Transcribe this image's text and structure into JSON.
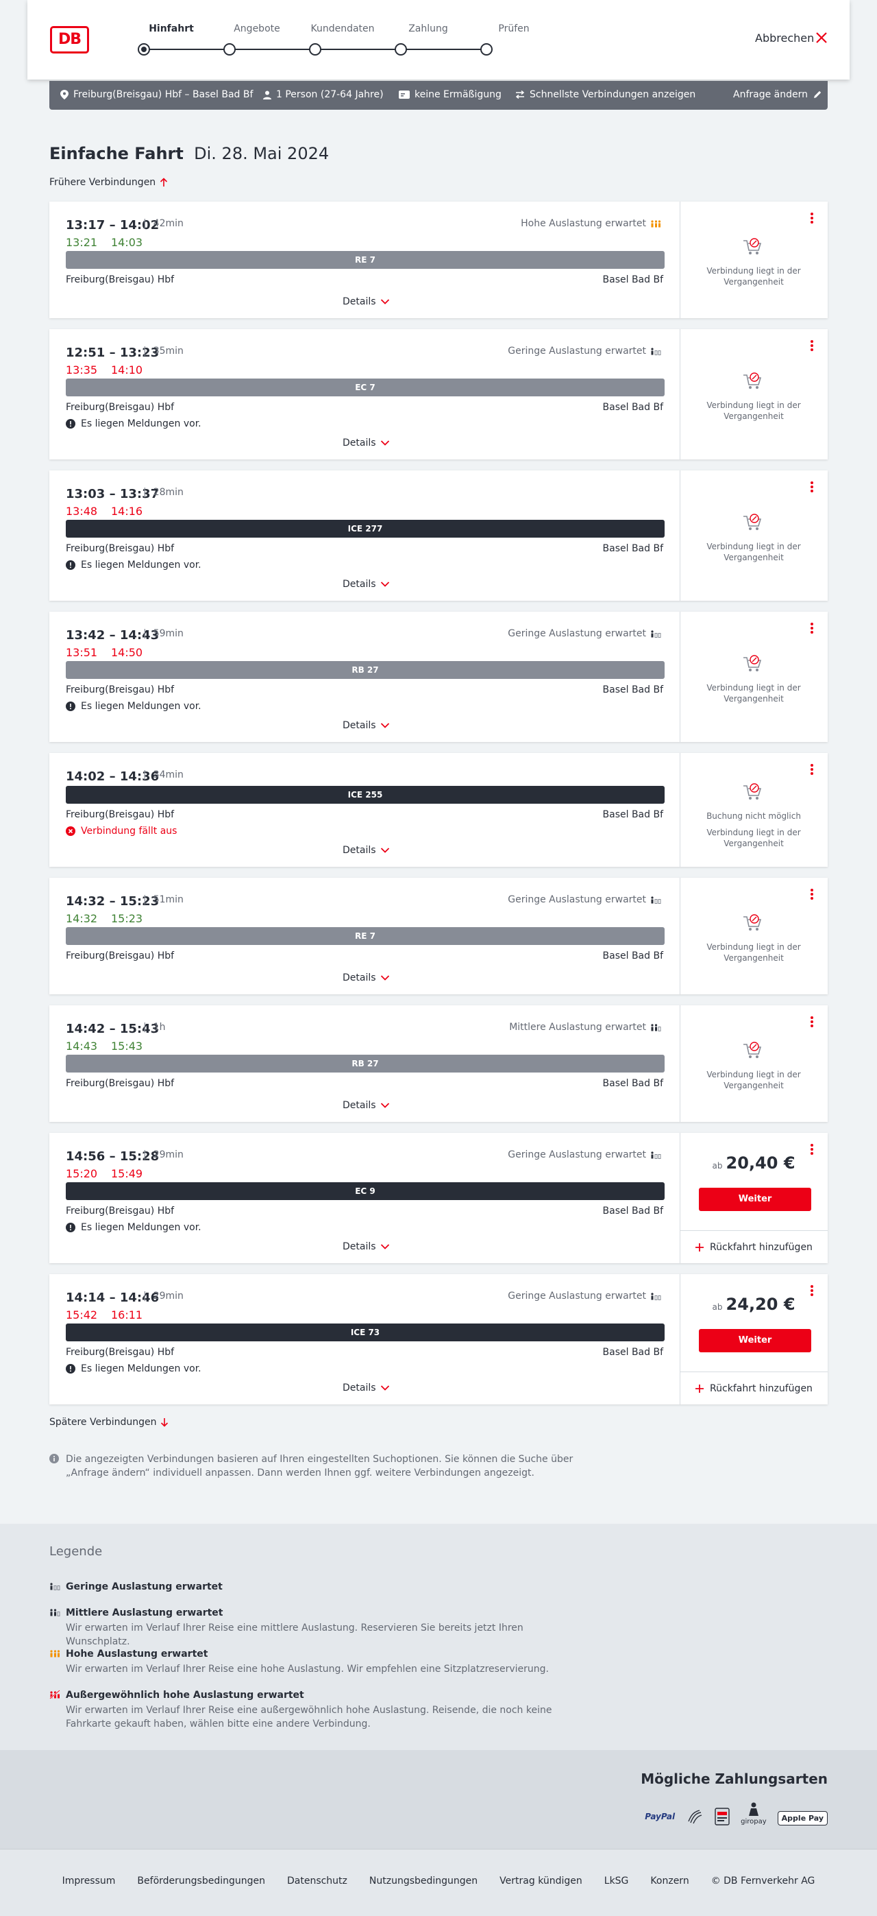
{
  "header": {
    "logo": "DB",
    "steps": [
      "Hinfahrt",
      "Angebote",
      "Kundendaten",
      "Zahlung",
      "Prüfen"
    ],
    "active_step": 0,
    "cancel_label": "Abbrechen"
  },
  "search": {
    "route": "Freiburg(Breisgau) Hbf – Basel Bad Bf",
    "travellers": "1 Person (27-64 Jahre)",
    "discount": "keine Ermäßigung",
    "fastest": "Schnellste Verbindungen anzeigen",
    "change": "Anfrage ändern"
  },
  "title": {
    "kind": "Einfache Fahrt",
    "date": "Di. 28. Mai 2024"
  },
  "earlier_label": "Frühere Verbindungen",
  "later_label": "Spätere Verbindungen",
  "details_label": "Details",
  "past_text": "Verbindung liegt in der Vergangenheit",
  "not_bookable_text": "Buchung nicht möglich",
  "price_prefix": "ab",
  "continue_label": "Weiter",
  "return_label": "Rückfahrt hinzufügen",
  "connections": [
    {
      "time": "13:17 – 14:02",
      "duration": "42min",
      "occupancy": "Hohe Auslastung erwartet",
      "occ_level": "high",
      "rt_dep": "13:21",
      "rt_arr": "14:03",
      "rt_color": "green",
      "train": "RE 7",
      "train_style": "light",
      "from": "Freiburg(Breisgau) Hbf",
      "to": "Basel Bad Bf",
      "message": ""
    },
    {
      "time": "12:51 – 13:23",
      "duration": "35min",
      "occupancy": "Geringe Auslastung erwartet",
      "occ_level": "low",
      "rt_dep": "13:35",
      "rt_arr": "14:10",
      "rt_color": "red",
      "train": "EC 7",
      "train_style": "light",
      "from": "Freiburg(Breisgau) Hbf",
      "to": "Basel Bad Bf",
      "message": "Es liegen Meldungen vor."
    },
    {
      "time": "13:03 – 13:37",
      "duration": "28min",
      "occupancy": "",
      "rt_dep": "13:48",
      "rt_arr": "14:16",
      "rt_color": "red",
      "train": "ICE 277",
      "train_style": "dark",
      "from": "Freiburg(Breisgau) Hbf",
      "to": "Basel Bad Bf",
      "message": "Es liegen Meldungen vor."
    },
    {
      "time": "13:42 – 14:43",
      "duration": "59min",
      "occupancy": "Geringe Auslastung erwartet",
      "occ_level": "low",
      "rt_dep": "13:51",
      "rt_arr": "14:50",
      "rt_color": "red",
      "train": "RB 27",
      "train_style": "light",
      "from": "Freiburg(Breisgau) Hbf",
      "to": "Basel Bad Bf",
      "message": "Es liegen Meldungen vor."
    },
    {
      "time": "14:02 – 14:36",
      "duration": "34min",
      "occupancy": "",
      "train": "ICE 255",
      "train_style": "dark",
      "from": "Freiburg(Breisgau) Hbf",
      "to": "Basel Bad Bf",
      "message": "Verbindung fällt aus"
    },
    {
      "time": "14:32 – 15:23",
      "duration": "51min",
      "occupancy": "Geringe Auslastung erwartet",
      "occ_level": "low",
      "rt_dep": "14:32",
      "rt_arr": "15:23",
      "rt_color": "green",
      "train": "RE 7",
      "train_style": "light",
      "from": "Freiburg(Breisgau) Hbf",
      "to": "Basel Bad Bf",
      "message": ""
    },
    {
      "time": "14:42 – 15:43",
      "duration": "1h",
      "occupancy": "Mittlere Auslastung erwartet",
      "occ_level": "medium",
      "rt_dep": "14:43",
      "rt_arr": "15:43",
      "rt_color": "green",
      "train": "RB 27",
      "train_style": "light",
      "from": "Freiburg(Breisgau) Hbf",
      "to": "Basel Bad Bf",
      "message": ""
    },
    {
      "time": "14:56 – 15:28",
      "duration": "29min",
      "occupancy": "Geringe Auslastung erwartet",
      "occ_level": "low",
      "rt_dep": "15:20",
      "rt_arr": "15:49",
      "rt_color": "red",
      "train": "EC 9",
      "train_style": "dark",
      "from": "Freiburg(Breisgau) Hbf",
      "to": "Basel Bad Bf",
      "message": "Es liegen Meldungen vor.",
      "price": "20,40 €"
    },
    {
      "time": "14:14 – 14:46",
      "duration": "29min",
      "occupancy": "Geringe Auslastung erwartet",
      "occ_level": "low",
      "rt_dep": "15:42",
      "rt_arr": "16:11",
      "rt_color": "red",
      "train": "ICE 73",
      "train_style": "dark",
      "from": "Freiburg(Breisgau) Hbf",
      "to": "Basel Bad Bf",
      "message": "Es liegen Meldungen vor.",
      "price": "24,20 €"
    }
  ],
  "info_note": "Die angezeigten Verbindungen basieren auf Ihren eingestellten Suchoptionen. Sie können die Suche über „Anfrage ändern“ individuell anpassen. Dann werden Ihnen ggf. weitere Verbindungen angezeigt.",
  "legend": {
    "title": "Legende",
    "items": [
      {
        "head": "Geringe Auslastung erwartet",
        "text": ""
      },
      {
        "head": "Mittlere Auslastung erwartet",
        "text": "Wir erwarten im Verlauf Ihrer Reise eine mittlere Auslastung. Reservieren Sie bereits jetzt Ihren Wunschplatz."
      },
      {
        "head": "Hohe Auslastung erwartet",
        "text": "Wir erwarten im Verlauf Ihrer Reise eine hohe Auslastung. Wir empfehlen eine Sitzplatzreservierung."
      },
      {
        "head": "Außergewöhnlich hohe Auslastung erwartet",
        "text": "Wir erwarten im Verlauf Ihrer Reise eine außergewöhnlich hohe Auslastung. Reisende, die noch keine Fahrkarte gekauft haben, wählen bitte eine andere Verbindung."
      }
    ]
  },
  "payment": {
    "title": "Mögliche Zahlungsarten",
    "methods": [
      "PayPal",
      "giropay",
      "Apple Pay"
    ]
  },
  "footer": [
    "Impressum",
    "Beförderungsbedingungen",
    "Datenschutz",
    "Nutzungsbedingungen",
    "Vertrag kündigen",
    "LkSG",
    "Konzern",
    "© DB Fernverkehr AG"
  ],
  "colors": {
    "accent": "#ec0016",
    "delay": "#ec0016",
    "ontime": "#408335",
    "occupancy_high": "#f39200"
  }
}
